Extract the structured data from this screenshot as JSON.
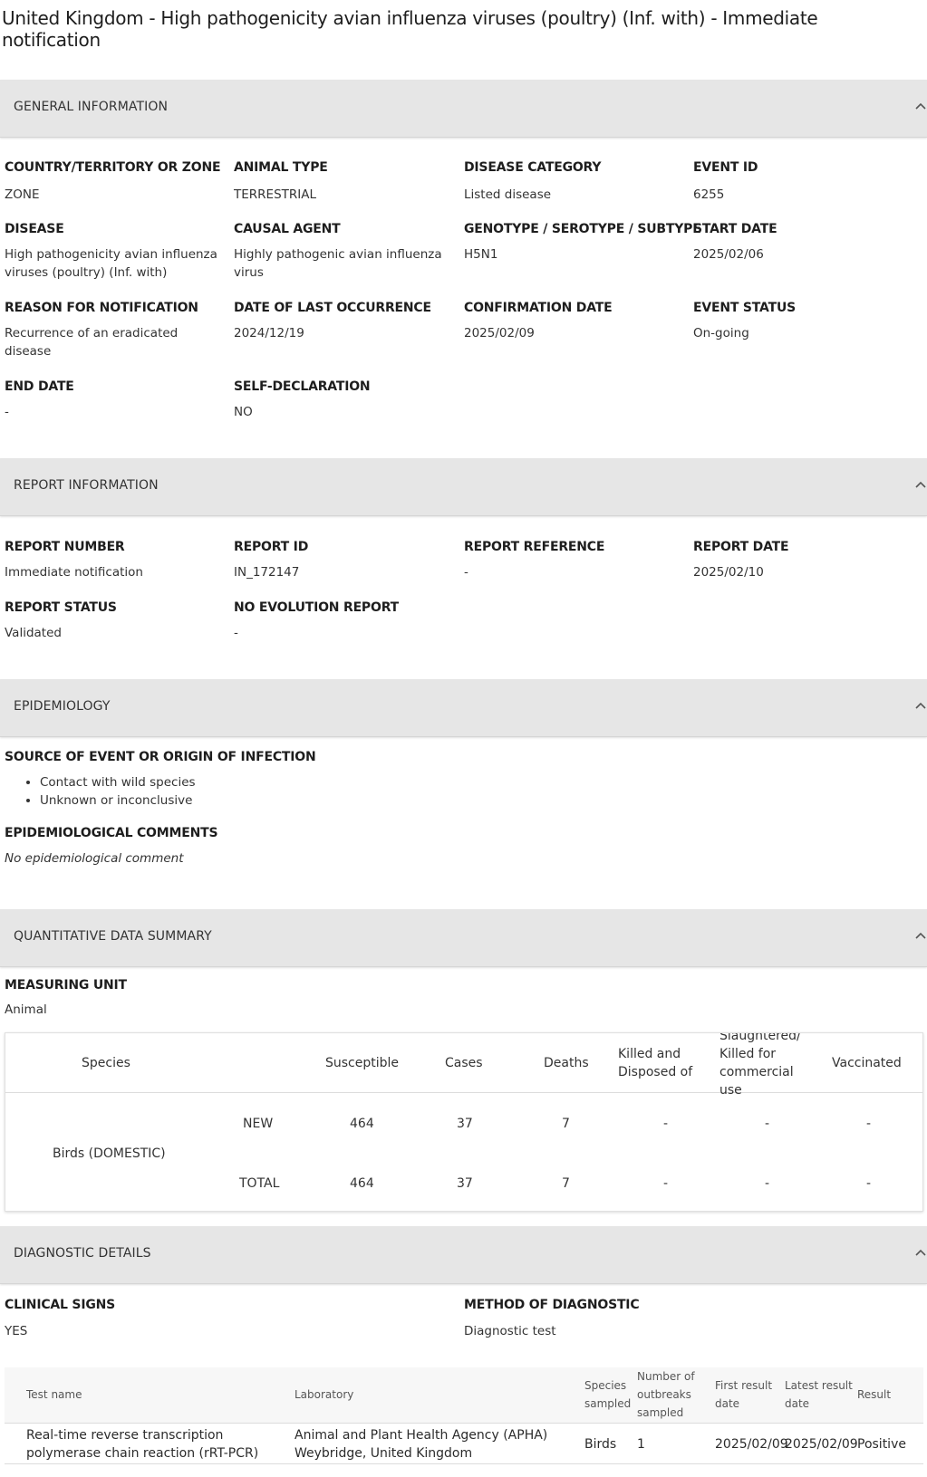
{
  "page": {
    "title": "United Kingdom - High pathogenicity avian influenza viruses (poultry) (Inf. with) - Immediate notification"
  },
  "sections": {
    "general": "GENERAL INFORMATION",
    "report": "REPORT INFORMATION",
    "epi": "EPIDEMIOLOGY",
    "quant": "QUANTITATIVE DATA SUMMARY",
    "diag": "DIAGNOSTIC DETAILS"
  },
  "general": {
    "country_label": "COUNTRY/TERRITORY OR ZONE",
    "country_value": "ZONE",
    "animal_type_label": "ANIMAL TYPE",
    "animal_type_value": "TERRESTRIAL",
    "disease_category_label": "DISEASE CATEGORY",
    "disease_category_value": "Listed disease",
    "event_id_label": "EVENT ID",
    "event_id_value": "6255",
    "disease_label": "DISEASE",
    "disease_value": "High pathogenicity avian influenza viruses (poultry) (Inf. with)",
    "causal_agent_label": "CAUSAL AGENT",
    "causal_agent_value": "Highly pathogenic avian influenza virus",
    "genotype_label": "GENOTYPE / SEROTYPE / SUBTYPE",
    "genotype_value": "H5N1",
    "start_date_label": "START DATE",
    "start_date_value": "2025/02/06",
    "reason_label": "REASON FOR NOTIFICATION",
    "reason_value": "Recurrence of an eradicated disease",
    "last_occurrence_label": "DATE OF LAST OCCURRENCE",
    "last_occurrence_value": "2024/12/19",
    "confirmation_label": "CONFIRMATION DATE",
    "confirmation_value": "2025/02/09",
    "event_status_label": "EVENT STATUS",
    "event_status_value": "On-going",
    "end_date_label": "END DATE",
    "end_date_value": "-",
    "self_decl_label": "SELF-DECLARATION",
    "self_decl_value": "NO"
  },
  "report": {
    "number_label": "REPORT NUMBER",
    "number_value": "Immediate notification",
    "id_label": "REPORT ID",
    "id_value": "IN_172147",
    "reference_label": "REPORT REFERENCE",
    "reference_value": "-",
    "date_label": "REPORT DATE",
    "date_value": "2025/02/10",
    "status_label": "REPORT STATUS",
    "status_value": "Validated",
    "no_evolution_label": "NO EVOLUTION REPORT",
    "no_evolution_value": "-"
  },
  "epi": {
    "source_label": "SOURCE OF EVENT OR ORIGIN OF INFECTION",
    "sources": [
      "Contact with wild species",
      "Unknown or inconclusive"
    ],
    "comments_label": "EPIDEMIOLOGICAL COMMENTS",
    "comments_value": "No epidemiological comment"
  },
  "quant": {
    "unit_label": "MEASURING UNIT",
    "unit_value": "Animal",
    "headers": {
      "species": "Species",
      "susceptible": "Susceptible",
      "cases": "Cases",
      "deaths": "Deaths",
      "killed": "Killed and Disposed of",
      "slaughtered": "Slaughtered/ Killed for commercial use",
      "vaccinated": "Vaccinated"
    },
    "species_name": "Birds (DOMESTIC)",
    "rows": [
      {
        "label": "NEW",
        "susceptible": "464",
        "cases": "37",
        "deaths": "7",
        "killed": "-",
        "slaughtered": "-",
        "vaccinated": "-"
      },
      {
        "label": "TOTAL",
        "susceptible": "464",
        "cases": "37",
        "deaths": "7",
        "killed": "-",
        "slaughtered": "-",
        "vaccinated": "-"
      }
    ]
  },
  "diag": {
    "clinical_label": "CLINICAL SIGNS",
    "clinical_value": "YES",
    "method_label": "METHOD OF DIAGNOSTIC",
    "method_value": "Diagnostic test",
    "headers": {
      "test_name": "Test name",
      "laboratory": "Laboratory",
      "species_sampled": "Species sampled",
      "outbreaks_sampled": "Number of outbreaks sampled",
      "first_result": "First result date",
      "latest_result": "Latest result date",
      "result": "Result"
    },
    "row": {
      "test_name": "Real-time reverse transcription polymerase chain reaction (rRT-PCR)",
      "laboratory": "Animal and Plant Health Agency (APHA) Weybridge, United Kingdom",
      "species_sampled": "Birds",
      "outbreaks_sampled": "1",
      "first_result": "2025/02/09",
      "latest_result": "2025/02/09",
      "result": "Positive"
    }
  }
}
